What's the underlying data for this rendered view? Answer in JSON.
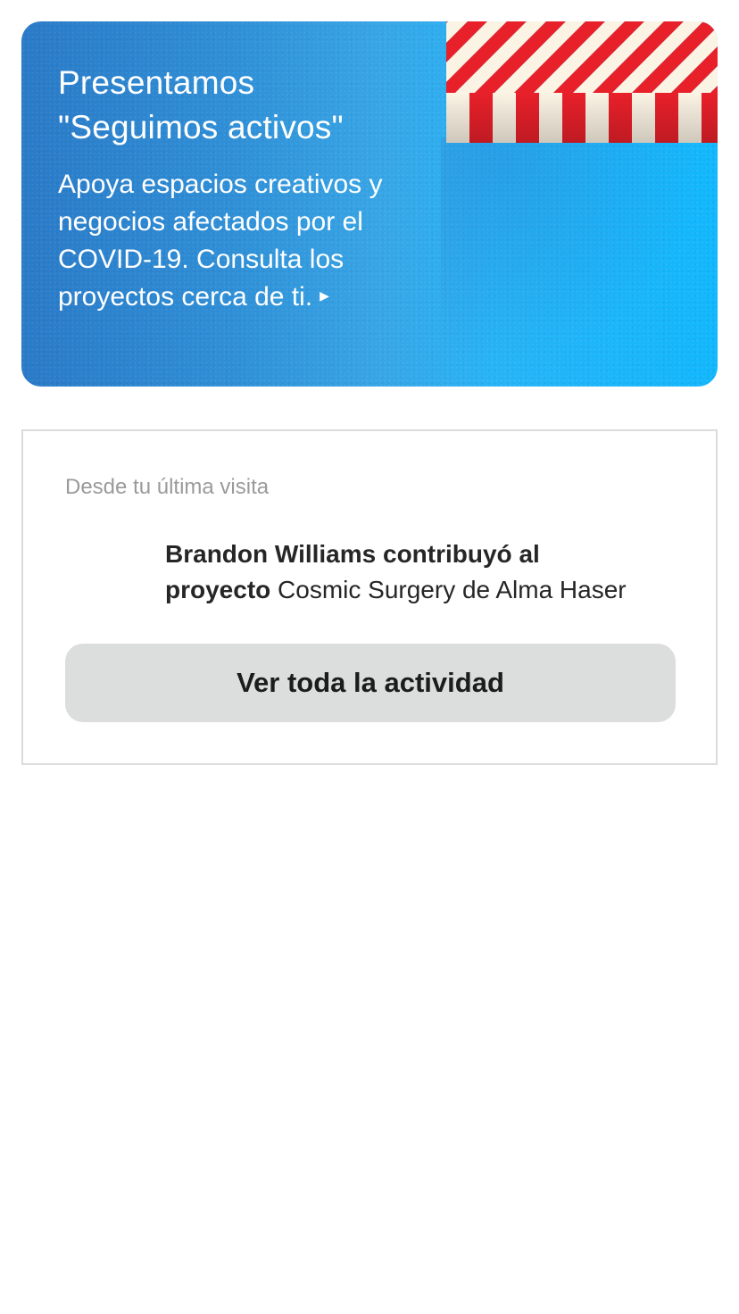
{
  "banner": {
    "title_line1": "Presentamos",
    "title_line2": "\"Seguimos activos\"",
    "body": "Apoya espacios creativos y negocios afectados por el COVID-19. Consulta los proyectos cerca de ti.",
    "arrow_icon": "play-arrow-icon",
    "illustration": "striped-awning-icon",
    "colors": {
      "gradient_start": "#2a7ac7",
      "gradient_end": "#12b7fc",
      "awning_red": "#e8202a",
      "awning_cream": "#fbf3e4"
    }
  },
  "activity": {
    "header": "Desde tu última visita",
    "item": {
      "actor_action": "Brandon Williams contribuyó al",
      "object_prefix": "proyecto",
      "project": "Cosmic Surgery de Alma Haser"
    },
    "view_all_label": "Ver toda la actividad"
  }
}
